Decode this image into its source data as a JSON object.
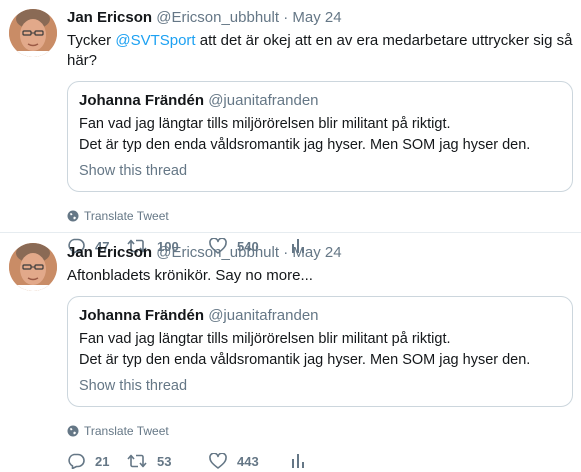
{
  "tweets": [
    {
      "fullname": "Jan Ericson",
      "username": "@Ericson_ubbhult",
      "dot": "·",
      "time": "May 24",
      "text_before": "Tycker ",
      "mention": "@SVTSport",
      "text_after": " att det är okej att en av era medarbetare uttrycker sig så här?",
      "quote": {
        "name": "Johanna Frändén",
        "username": "@juanitafranden",
        "line1": "Fan vad jag längtar tills miljörörelsen blir militant på riktigt.",
        "line2": "Det är typ den enda våldsromantik jag hyser. Men SOM jag hyser den.",
        "thread": "Show this thread"
      },
      "translate": "Translate Tweet",
      "replies": "47",
      "retweets": "100",
      "likes": "540"
    },
    {
      "fullname": "Jan Ericson",
      "username": "@Ericson_ubbhult",
      "dot": "·",
      "time": "May 24",
      "text": "Aftonbladets krönikör. Say no more...",
      "quote": {
        "name": "Johanna Frändén",
        "username": "@juanitafranden",
        "line1": "Fan vad jag längtar tills miljörörelsen blir militant på riktigt.",
        "line2": "Det är typ den enda våldsromantik jag hyser. Men SOM jag hyser den.",
        "thread": "Show this thread"
      },
      "translate": "Translate Tweet",
      "replies": "21",
      "retweets": "53",
      "likes": "443"
    }
  ],
  "colors": {
    "accent": "#1da1f2",
    "muted": "#657786",
    "text": "#14171a",
    "border": "#ccd6dd"
  },
  "icons": [
    "avatar",
    "globe-icon",
    "reply-icon",
    "retweet-icon",
    "like-icon",
    "analytics-icon"
  ]
}
